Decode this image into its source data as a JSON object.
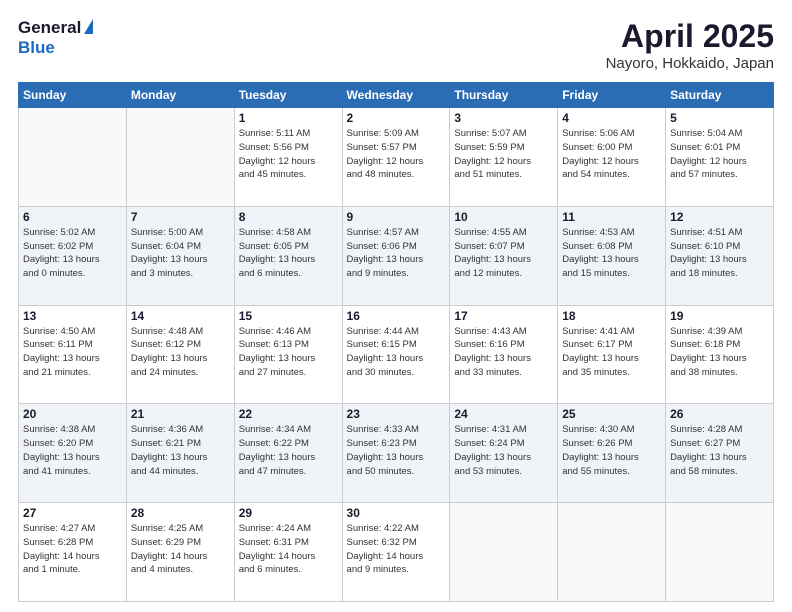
{
  "header": {
    "logo_general": "General",
    "logo_blue": "Blue",
    "title": "April 2025",
    "location": "Nayoro, Hokkaido, Japan"
  },
  "weekdays": [
    "Sunday",
    "Monday",
    "Tuesday",
    "Wednesday",
    "Thursday",
    "Friday",
    "Saturday"
  ],
  "weeks": [
    [
      {
        "day": "",
        "info": ""
      },
      {
        "day": "",
        "info": ""
      },
      {
        "day": "1",
        "info": "Sunrise: 5:11 AM\nSunset: 5:56 PM\nDaylight: 12 hours\nand 45 minutes."
      },
      {
        "day": "2",
        "info": "Sunrise: 5:09 AM\nSunset: 5:57 PM\nDaylight: 12 hours\nand 48 minutes."
      },
      {
        "day": "3",
        "info": "Sunrise: 5:07 AM\nSunset: 5:59 PM\nDaylight: 12 hours\nand 51 minutes."
      },
      {
        "day": "4",
        "info": "Sunrise: 5:06 AM\nSunset: 6:00 PM\nDaylight: 12 hours\nand 54 minutes."
      },
      {
        "day": "5",
        "info": "Sunrise: 5:04 AM\nSunset: 6:01 PM\nDaylight: 12 hours\nand 57 minutes."
      }
    ],
    [
      {
        "day": "6",
        "info": "Sunrise: 5:02 AM\nSunset: 6:02 PM\nDaylight: 13 hours\nand 0 minutes."
      },
      {
        "day": "7",
        "info": "Sunrise: 5:00 AM\nSunset: 6:04 PM\nDaylight: 13 hours\nand 3 minutes."
      },
      {
        "day": "8",
        "info": "Sunrise: 4:58 AM\nSunset: 6:05 PM\nDaylight: 13 hours\nand 6 minutes."
      },
      {
        "day": "9",
        "info": "Sunrise: 4:57 AM\nSunset: 6:06 PM\nDaylight: 13 hours\nand 9 minutes."
      },
      {
        "day": "10",
        "info": "Sunrise: 4:55 AM\nSunset: 6:07 PM\nDaylight: 13 hours\nand 12 minutes."
      },
      {
        "day": "11",
        "info": "Sunrise: 4:53 AM\nSunset: 6:08 PM\nDaylight: 13 hours\nand 15 minutes."
      },
      {
        "day": "12",
        "info": "Sunrise: 4:51 AM\nSunset: 6:10 PM\nDaylight: 13 hours\nand 18 minutes."
      }
    ],
    [
      {
        "day": "13",
        "info": "Sunrise: 4:50 AM\nSunset: 6:11 PM\nDaylight: 13 hours\nand 21 minutes."
      },
      {
        "day": "14",
        "info": "Sunrise: 4:48 AM\nSunset: 6:12 PM\nDaylight: 13 hours\nand 24 minutes."
      },
      {
        "day": "15",
        "info": "Sunrise: 4:46 AM\nSunset: 6:13 PM\nDaylight: 13 hours\nand 27 minutes."
      },
      {
        "day": "16",
        "info": "Sunrise: 4:44 AM\nSunset: 6:15 PM\nDaylight: 13 hours\nand 30 minutes."
      },
      {
        "day": "17",
        "info": "Sunrise: 4:43 AM\nSunset: 6:16 PM\nDaylight: 13 hours\nand 33 minutes."
      },
      {
        "day": "18",
        "info": "Sunrise: 4:41 AM\nSunset: 6:17 PM\nDaylight: 13 hours\nand 35 minutes."
      },
      {
        "day": "19",
        "info": "Sunrise: 4:39 AM\nSunset: 6:18 PM\nDaylight: 13 hours\nand 38 minutes."
      }
    ],
    [
      {
        "day": "20",
        "info": "Sunrise: 4:38 AM\nSunset: 6:20 PM\nDaylight: 13 hours\nand 41 minutes."
      },
      {
        "day": "21",
        "info": "Sunrise: 4:36 AM\nSunset: 6:21 PM\nDaylight: 13 hours\nand 44 minutes."
      },
      {
        "day": "22",
        "info": "Sunrise: 4:34 AM\nSunset: 6:22 PM\nDaylight: 13 hours\nand 47 minutes."
      },
      {
        "day": "23",
        "info": "Sunrise: 4:33 AM\nSunset: 6:23 PM\nDaylight: 13 hours\nand 50 minutes."
      },
      {
        "day": "24",
        "info": "Sunrise: 4:31 AM\nSunset: 6:24 PM\nDaylight: 13 hours\nand 53 minutes."
      },
      {
        "day": "25",
        "info": "Sunrise: 4:30 AM\nSunset: 6:26 PM\nDaylight: 13 hours\nand 55 minutes."
      },
      {
        "day": "26",
        "info": "Sunrise: 4:28 AM\nSunset: 6:27 PM\nDaylight: 13 hours\nand 58 minutes."
      }
    ],
    [
      {
        "day": "27",
        "info": "Sunrise: 4:27 AM\nSunset: 6:28 PM\nDaylight: 14 hours\nand 1 minute."
      },
      {
        "day": "28",
        "info": "Sunrise: 4:25 AM\nSunset: 6:29 PM\nDaylight: 14 hours\nand 4 minutes."
      },
      {
        "day": "29",
        "info": "Sunrise: 4:24 AM\nSunset: 6:31 PM\nDaylight: 14 hours\nand 6 minutes."
      },
      {
        "day": "30",
        "info": "Sunrise: 4:22 AM\nSunset: 6:32 PM\nDaylight: 14 hours\nand 9 minutes."
      },
      {
        "day": "",
        "info": ""
      },
      {
        "day": "",
        "info": ""
      },
      {
        "day": "",
        "info": ""
      }
    ]
  ]
}
